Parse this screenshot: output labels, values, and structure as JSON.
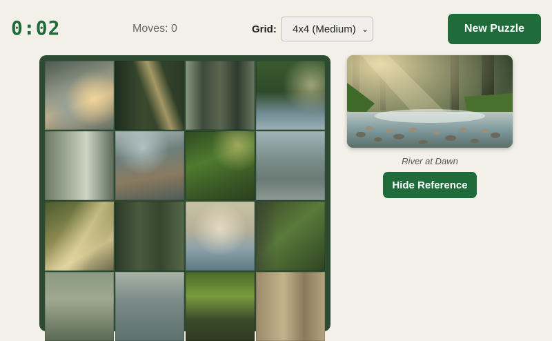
{
  "header": {
    "timer": "0:02",
    "moves_label": "Moves: 0",
    "grid_label": "Grid:",
    "grid_select_value": "4x4 (Medium)",
    "new_puzzle_label": "New Puzzle"
  },
  "reference": {
    "caption": "River at Dawn",
    "hide_label": "Hide Reference"
  },
  "board": {
    "rows": 4,
    "cols": 4,
    "tiles": [
      {
        "content": "pebbles-bright"
      },
      {
        "content": "forest-sunbeam"
      },
      {
        "content": "forest-trunks"
      },
      {
        "content": "ferns-water"
      },
      {
        "content": "forest-misty"
      },
      {
        "content": "pebbles-water"
      },
      {
        "content": "ferns-green"
      },
      {
        "content": "pebbles-blue"
      },
      {
        "content": "branch-light"
      },
      {
        "content": "forest-dark"
      },
      {
        "content": "misty-water"
      },
      {
        "content": "trunk-ferns"
      },
      {
        "content": "water-rocks"
      },
      {
        "content": "pebbles-water-bottom"
      },
      {
        "content": "mossy-log"
      },
      {
        "content": "light-haze"
      }
    ]
  },
  "colors": {
    "accent": "#1f6b3a",
    "board": "#2d4a33",
    "background": "#f3f0e9"
  }
}
